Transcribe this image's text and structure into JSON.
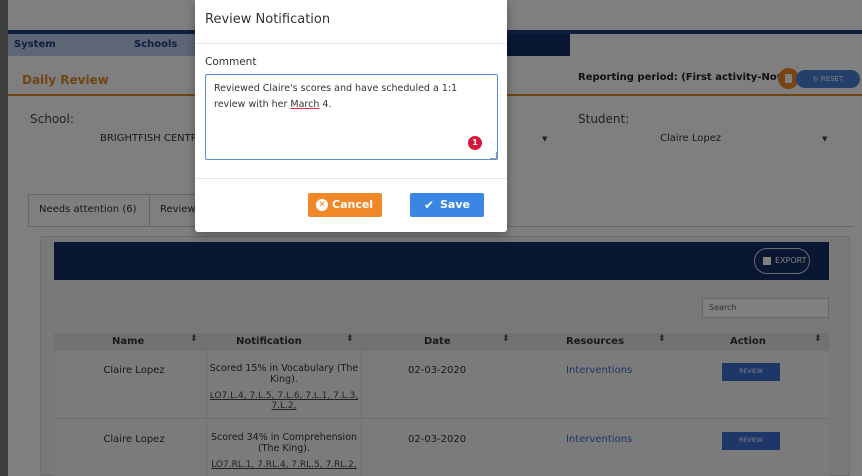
{
  "nav": {
    "tabs": [
      "System",
      "Schools"
    ]
  },
  "header": {
    "title": "Daily Review",
    "reporting_period": "Reporting period: (First activity-Now)",
    "reset_label": "↻ RESET"
  },
  "filters": {
    "school_label": "School:",
    "school_value": "BRIGHTFISH CENTRA",
    "student_label": "Student:",
    "student_value": "Claire Lopez"
  },
  "tabs": [
    "Needs attention (6)",
    "Review"
  ],
  "table": {
    "export_label": "EXPORT",
    "search_placeholder": "Search",
    "columns": [
      "Name",
      "Notification",
      "Date",
      "Resources",
      "Action"
    ],
    "rows": [
      {
        "name": "Claire Lopez",
        "notification": "Scored 15% in Vocabulary (The King).",
        "los": "LO7.L.4, 7.L.5, 7.L.6, 7.L.1, 7.L.3, 7.L.2,",
        "date": "02-03-2020",
        "resources": "Interventions",
        "action": "REVIEW"
      },
      {
        "name": "Claire Lopez",
        "notification": "Scored 34% in Comprehension (The King).",
        "los": "LO7.RL.1, 7.RL.4, 7.RL.5, 7.RL.2,",
        "date": "02-03-2020",
        "resources": "Interventions",
        "action": "REVIEW"
      }
    ]
  },
  "modal": {
    "title": "Review Notification",
    "comment_label": "Comment",
    "comment_text_1": "Reviewed Claire's scores and have scheduled a 1:1 review with her ",
    "comment_misspelled": "March",
    "comment_text_2": " 4.",
    "error_count": "1",
    "cancel_label": "Cancel",
    "save_label": "Save"
  },
  "colors": {
    "navy": "#132f66",
    "accent_orange": "#f0882a",
    "primary_blue": "#3b86e3"
  }
}
